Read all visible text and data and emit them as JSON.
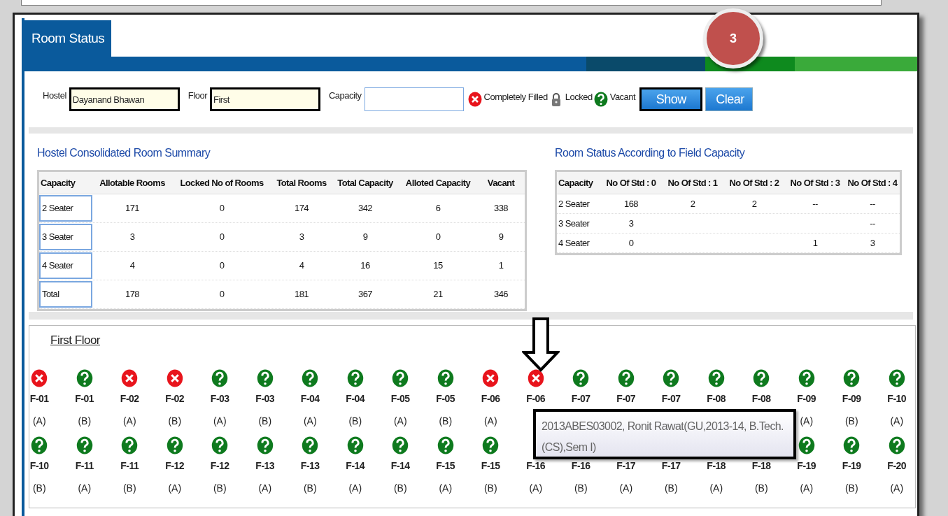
{
  "tab": {
    "label": "Room Status",
    "selected": true
  },
  "badge": "3",
  "filters": [
    {
      "label": "Hostel",
      "value": "Dayanand Bhawan",
      "highlighted": true
    },
    {
      "label": "Floor",
      "value": "First",
      "highlighted": true
    },
    {
      "label": "Capacity",
      "highlighted": false
    }
  ],
  "legend": [
    {
      "kind": "filled",
      "label": "Completely Filled"
    },
    {
      "kind": "locked",
      "label": "Locked"
    },
    {
      "kind": "vacant",
      "label": "Vacant"
    }
  ],
  "buttons": [
    {
      "label": "Show",
      "highlighted": true
    },
    {
      "label": "Clear",
      "highlighted": false
    }
  ],
  "summary": {
    "title": "Hostel Consolidated Room Summary",
    "columns": [
      "Capacity",
      "Allotable Rooms",
      "Locked No of Rooms",
      "Total Rooms",
      "Total Capacity",
      "Alloted Capacity",
      "Vacant"
    ],
    "rows": [
      [
        "2 Seater",
        "171",
        "0",
        "174",
        "342",
        "6",
        "338"
      ],
      [
        "3 Seater",
        "3",
        "0",
        "3",
        "9",
        "0",
        "9"
      ],
      [
        "4 Seater",
        "4",
        "0",
        "4",
        "16",
        "15",
        "1"
      ],
      [
        "Total",
        "178",
        "0",
        "181",
        "367",
        "21",
        "346"
      ]
    ]
  },
  "field_capacity": {
    "title": "Room Status According to Field Capacity",
    "columns": [
      "Capacity",
      "No Of Std : 0",
      "No Of Std : 1",
      "No Of Std : 2",
      "No Of Std : 3",
      "No Of Std : 4"
    ],
    "rows": [
      [
        "2 Seater",
        "168",
        "2",
        "2",
        "--",
        "--"
      ],
      [
        "3 Seater",
        "3",
        null,
        null,
        null,
        "--"
      ],
      [
        "4 Seater",
        "0",
        null,
        null,
        "1",
        "3"
      ]
    ]
  },
  "floor": {
    "title": "First Floor",
    "rooms": [
      {
        "code": "F-01",
        "letter": "(A)",
        "kind": "filled"
      },
      {
        "code": "F-01",
        "letter": "(B)",
        "kind": "vacant"
      },
      {
        "code": "F-02",
        "letter": "(A)",
        "kind": "filled"
      },
      {
        "code": "F-02",
        "letter": "(B)",
        "kind": "filled"
      },
      {
        "code": "F-03",
        "letter": "(A)",
        "kind": "vacant"
      },
      {
        "code": "F-03",
        "letter": "(B)",
        "kind": "vacant"
      },
      {
        "code": "F-04",
        "letter": "(A)",
        "kind": "vacant"
      },
      {
        "code": "F-04",
        "letter": "(B)",
        "kind": "vacant"
      },
      {
        "code": "F-05",
        "letter": "(A)",
        "kind": "vacant"
      },
      {
        "code": "F-05",
        "letter": "(B)",
        "kind": "vacant"
      },
      {
        "code": "F-06",
        "letter": "(A)",
        "kind": "filled"
      },
      {
        "code": "F-06",
        "kind": "filled"
      },
      {
        "code": "F-07",
        "kind": "vacant"
      },
      {
        "code": "F-07",
        "kind": "vacant"
      },
      {
        "code": "F-07",
        "kind": "vacant"
      },
      {
        "code": "F-08",
        "kind": "vacant"
      },
      {
        "code": "F-08",
        "kind": "vacant"
      },
      {
        "code": "F-09",
        "letter": "(A)",
        "kind": "vacant"
      },
      {
        "code": "F-09",
        "letter": "(B)",
        "kind": "vacant"
      },
      {
        "code": "F-10",
        "letter": "(A)",
        "kind": "vacant"
      },
      {
        "code": "F-10",
        "letter": "(B)",
        "kind": "vacant"
      },
      {
        "code": "F-11",
        "letter": "(A)",
        "kind": "vacant"
      },
      {
        "code": "F-11",
        "letter": "(B)",
        "kind": "vacant"
      },
      {
        "code": "F-12",
        "letter": "(A)",
        "kind": "vacant"
      },
      {
        "code": "F-12",
        "letter": "(B)",
        "kind": "vacant"
      },
      {
        "code": "F-13",
        "letter": "(A)",
        "kind": "vacant"
      },
      {
        "code": "F-13",
        "letter": "(B)",
        "kind": "vacant"
      },
      {
        "code": "F-14",
        "letter": "(A)",
        "kind": "vacant"
      },
      {
        "code": "F-14",
        "letter": "(B)",
        "kind": "vacant"
      },
      {
        "code": "F-15",
        "letter": "(A)",
        "kind": "vacant"
      },
      {
        "code": "F-15",
        "letter": "(B)",
        "kind": "vacant"
      },
      {
        "code": "F-16",
        "letter": "(A)",
        "kind": "covered"
      },
      {
        "code": "F-16",
        "letter": "(B)",
        "kind": "covered"
      },
      {
        "code": "F-17",
        "letter": "(A)",
        "kind": "covered"
      },
      {
        "code": "F-17",
        "letter": "(B)",
        "kind": "covered"
      },
      {
        "code": "F-18",
        "letter": "(A)",
        "kind": "covered"
      },
      {
        "code": "F-18",
        "letter": "(B)",
        "kind": "covered"
      },
      {
        "code": "F-19",
        "letter": "(A)",
        "kind": "vacant"
      },
      {
        "code": "F-19",
        "letter": "(B)",
        "kind": "vacant"
      },
      {
        "code": "F-20",
        "letter": "(A)",
        "kind": "vacant"
      }
    ],
    "tooltip": "2013ABES03002, Ronit  Rawat(GU,2013-14, B.Tech.(CS),Sem I)"
  }
}
